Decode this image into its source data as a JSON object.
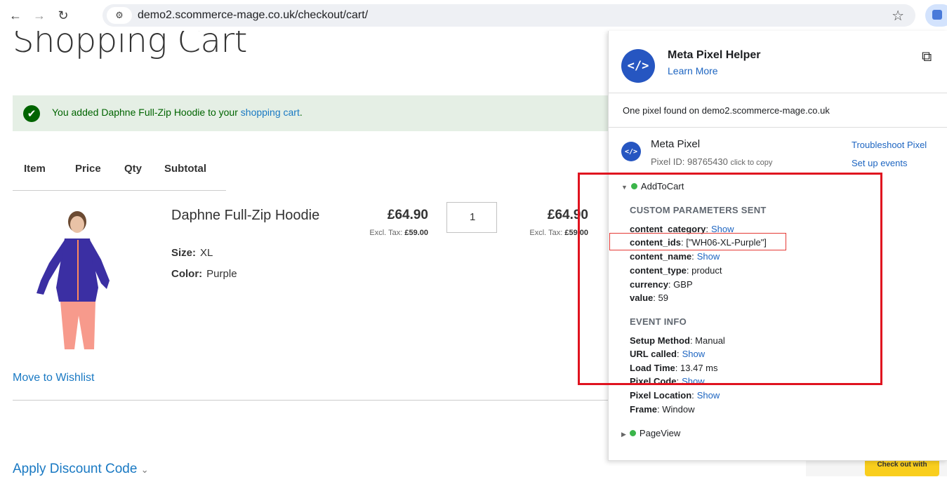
{
  "browser": {
    "url": "demo2.scommerce-mage.co.uk/checkout/cart/",
    "back_icon": "arrow-left",
    "forward_icon": "arrow-right",
    "reload_icon": "reload",
    "bookmark_icon": "star"
  },
  "page": {
    "title": "Shopping Cart",
    "message_prefix": "You added Daphne Full-Zip Hoodie to your ",
    "message_link": "shopping cart",
    "message_suffix": ".",
    "columns": [
      "Item",
      "Price",
      "Qty",
      "Subtotal"
    ],
    "item": {
      "name": "Daphne Full-Zip Hoodie",
      "size_label": "Size:",
      "size_value": "XL",
      "color_label": "Color:",
      "color_value": "Purple",
      "price": "£64.90",
      "price_excl_label": "Excl. Tax:",
      "price_excl_value": "£59.00",
      "qty": "1",
      "subtotal": "£64.90",
      "subtotal_excl_label": "Excl. Tax:",
      "subtotal_excl_value": "£59.00"
    },
    "move_to_wishlist": "Move to Wishlist",
    "apply_discount": "Apply Discount Code",
    "checkout_button": "Check out with"
  },
  "pixel_helper": {
    "title": "Meta Pixel Helper",
    "learn_more": "Learn More",
    "found_text": "One pixel found on demo2.scommerce-mage.co.uk",
    "pixel_name": "Meta Pixel",
    "pixel_id_label": "Pixel ID: 98765430",
    "click_to_copy": "click to copy",
    "troubleshoot": "Troubleshoot Pixel",
    "setup_events": "Set up events",
    "event1": "AddToCart",
    "custom_params_header": "CUSTOM PARAMETERS SENT",
    "params": [
      {
        "key": "content_category",
        "sep": ":",
        "value": "",
        "show": "Show"
      },
      {
        "key": "content_ids",
        "sep": ":",
        "value": " [\"WH06-XL-Purple\"]",
        "show": ""
      },
      {
        "key": "content_name",
        "sep": ":",
        "value": "",
        "show": "Show"
      },
      {
        "key": "content_type",
        "sep": ":",
        "value": " product",
        "show": ""
      },
      {
        "key": "currency",
        "sep": ":",
        "value": " GBP",
        "show": ""
      },
      {
        "key": "value",
        "sep": ":",
        "value": " 59",
        "show": ""
      }
    ],
    "event_info_header": "EVENT INFO",
    "info": [
      {
        "key": "Setup Method",
        "sep": ":",
        "value": " Manual",
        "show": ""
      },
      {
        "key": "URL called",
        "sep": ":",
        "value": "",
        "show": "Show"
      },
      {
        "key": "Load Time",
        "sep": ":",
        "value": " 13.47 ms",
        "show": ""
      },
      {
        "key": "Pixel Code",
        "sep": ":",
        "value": "",
        "show": "Show"
      },
      {
        "key": "Pixel Location",
        "sep": ":",
        "value": "",
        "show": "Show"
      },
      {
        "key": "Frame",
        "sep": ":",
        "value": " Window",
        "show": ""
      }
    ],
    "event2": "PageView",
    "accent_color": "#2656c1",
    "highlight_color": "#e0131f"
  }
}
